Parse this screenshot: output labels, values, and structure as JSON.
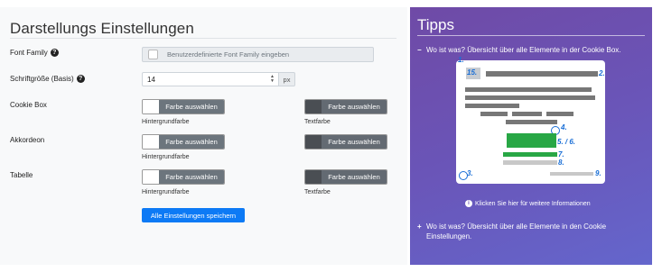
{
  "settings": {
    "title": "Darstellungs Einstellungen",
    "font_family": {
      "label": "Font Family",
      "placeholder": "Benutzerdefinierte Font Family eingeben"
    },
    "font_size": {
      "label": "Schriftgröße (Basis)",
      "value": "14",
      "unit": "px"
    },
    "rows": [
      {
        "label": "Cookie Box",
        "bg_button": "Farbe auswählen",
        "bg_caption": "Hintergrundfarbe",
        "text_button": "Farbe auswählen",
        "text_caption": "Textfarbe"
      },
      {
        "label": "Akkordeon",
        "bg_button": "Farbe auswählen",
        "bg_caption": "Hintergrundfarbe",
        "text_button": "Farbe auswählen",
        "text_caption": "Textfarbe"
      },
      {
        "label": "Tabelle",
        "bg_button": "Farbe auswählen",
        "bg_caption": "Hintergrundfarbe",
        "text_button": "Farbe auswählen",
        "text_caption": "Textfarbe"
      }
    ],
    "save_label": "Alle Einstellungen speichern"
  },
  "tips": {
    "title": "Tipps",
    "item1": "Wo ist was? Übersicht über alle Elemente in der Cookie Box.",
    "item1_symbol": "−",
    "item2": "Wo ist was? Übersicht über alle Elemente in den Cookie Einstellungen.",
    "item2_symbol": "+",
    "info_link": "Klicken Sie hier für weitere Informationen",
    "illustration_numbers": [
      "1.",
      "15.",
      "2.",
      "4.",
      "5. / 6.",
      "7.",
      "8.",
      "3.",
      "9."
    ]
  },
  "colors": {
    "accent": "#0d7af5",
    "tips_gradient_start": "#6f4aa6",
    "tips_gradient_end": "#6466cc",
    "picker_button": "#6c757d",
    "illustration_green": "#28a745"
  },
  "icons": {
    "help": "question-circle-icon",
    "info": "info-circle-icon"
  }
}
